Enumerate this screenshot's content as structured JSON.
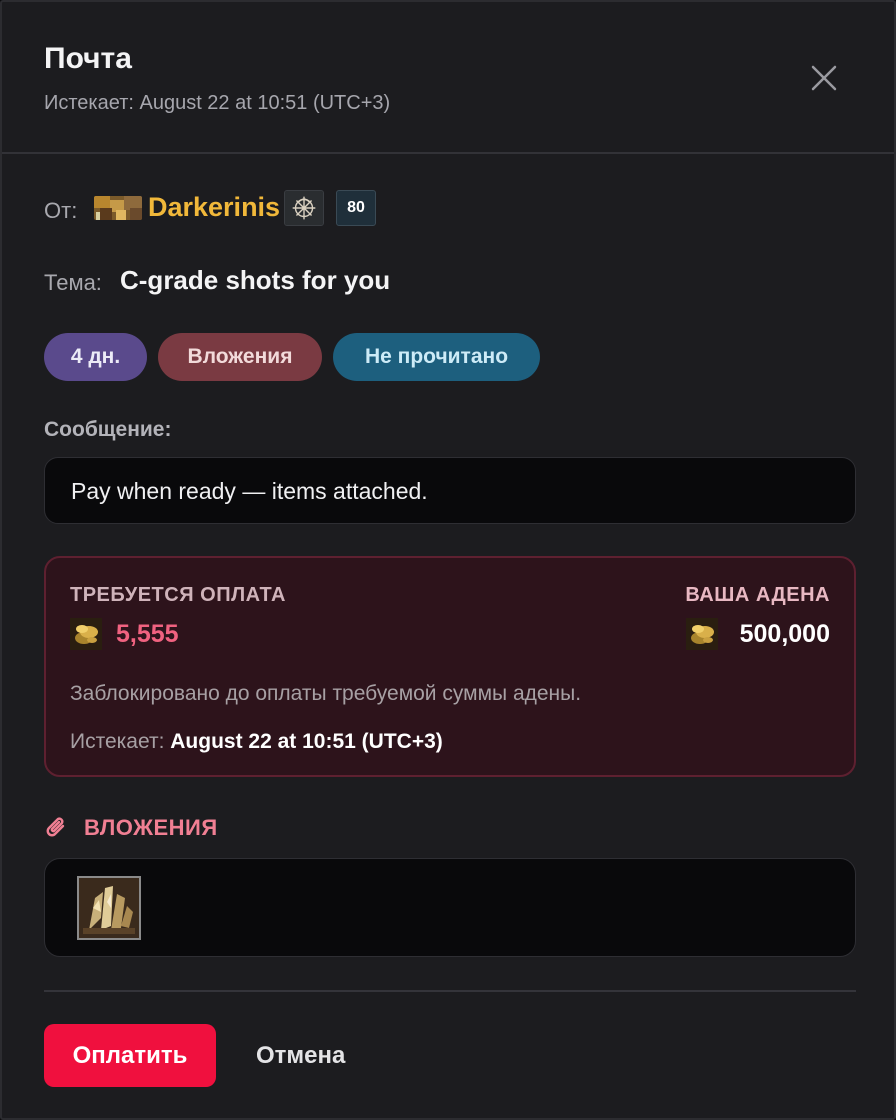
{
  "header": {
    "title": "Почта",
    "expires": "Истекает: August 22 at 10:51 (UTC+3)"
  },
  "from": {
    "label": "От:",
    "sender": "Darkerinis",
    "level": "80",
    "crest_icon": "clan-crest-icon",
    "portrait_icon": "character-portrait-icon"
  },
  "subject": {
    "label": "Тема:",
    "text": "C-grade shots for you"
  },
  "pills": {
    "days": "4 дн.",
    "attachments": "Вложения",
    "unread": "Не прочитано"
  },
  "message": {
    "label": "Сообщение:",
    "body": "Pay when ready — items attached."
  },
  "payment": {
    "required_label": "ТРЕБУЕТСЯ ОПЛАТА",
    "required_amount": "5,555",
    "balance_label": "ВАША АДЕНА",
    "balance_amount": "500,000",
    "note": "Заблокировано до оплаты требуемой суммы адены.",
    "expires_prefix": "Истекает:",
    "expires_value": "August 22 at 10:51 (UTC+3)",
    "coin_icon": "adena-coin-icon"
  },
  "attachments": {
    "heading": "ВЛОЖЕНИЯ",
    "icon": "paperclip-icon",
    "items": [
      {
        "icon": "soulshot-item-icon"
      }
    ]
  },
  "actions": {
    "pay": "Оплатить",
    "cancel": "Отмена"
  },
  "colors": {
    "accent": "#f0103e",
    "sender": "#f1b83a",
    "required_amount": "#f06280",
    "attachments_heading": "#f07f93"
  }
}
